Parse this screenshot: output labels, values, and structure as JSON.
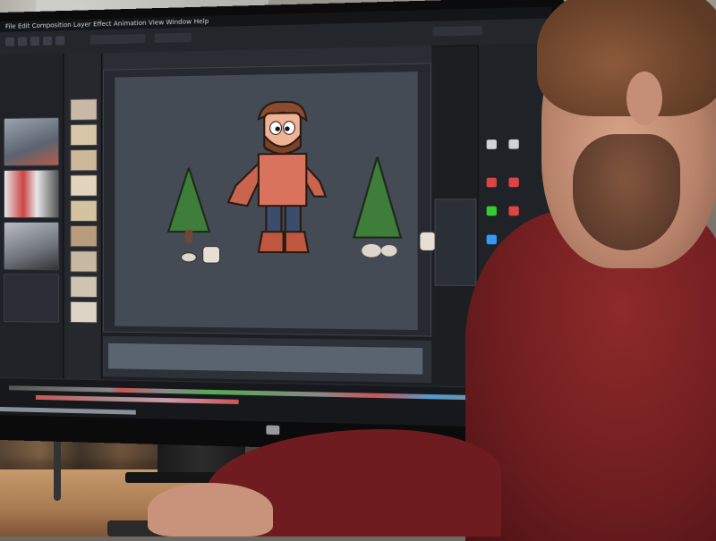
{
  "scene": {
    "description_tag": "",
    "colors": {
      "hoodie": "#6d1d1f",
      "app_bg": "#1c1e22",
      "canvas_bg": "#444b55",
      "character_shirt": "#d9735e",
      "character_pants": "#3a4d6c",
      "character_boots": "#c0573f",
      "tree_green": "#3f7d3a"
    }
  },
  "app": {
    "menu_text": "File  Edit  Composition  Layer  Effect  Animation  View  Window  Help",
    "viewport_tab": "",
    "icons": [
      "play-icon",
      "pause-icon",
      "select-icon",
      "brush-icon",
      "zoom-icon"
    ]
  },
  "monitor": {
    "brand": ""
  }
}
